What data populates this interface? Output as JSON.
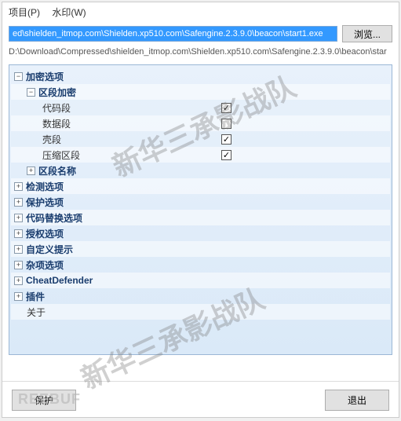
{
  "menu": {
    "project": "项目(P)",
    "watermark": "水印(W)"
  },
  "path_input": "ed\\shielden_itmop.com\\Shielden.xp510.com\\Safengine.2.3.9.0\\beacon\\start1.exe",
  "browse_label": "浏览...",
  "path_display": "D:\\Download\\Compressed\\shielden_itmop.com\\Shielden.xp510.com\\Safengine.2.3.9.0\\beacon\\star",
  "tree": {
    "encrypt_options": "加密选项",
    "section_encrypt": "区段加密",
    "code_section": "代码段",
    "data_section": "数据段",
    "shell_section": "壳段",
    "compress_section": "压缩区段",
    "section_name": "区段名称",
    "detect_options": "检测选项",
    "protect_options": "保护选项",
    "code_replace_options": "代码替换选项",
    "auth_options": "授权选项",
    "custom_prompt": "自定义提示",
    "misc_options": "杂项选项",
    "cheat_defender": "CheatDefender",
    "plugins": "插件",
    "about": "关于"
  },
  "checks": {
    "code": true,
    "data": false,
    "shell": true,
    "compress": true
  },
  "buttons": {
    "protect": "保护",
    "exit": "退出"
  },
  "watermark_text": "新华三承影战队",
  "logo_text": "REEBUF"
}
